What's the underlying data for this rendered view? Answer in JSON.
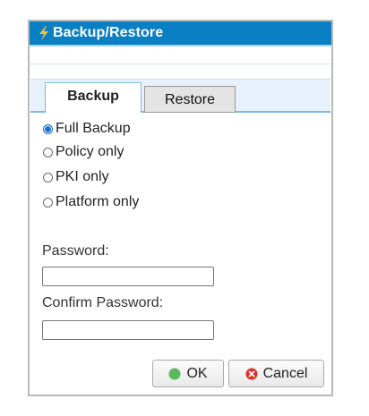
{
  "dialog": {
    "title": "Backup/Restore",
    "tabs": [
      {
        "label": "Backup",
        "active": true
      },
      {
        "label": "Restore",
        "active": false
      }
    ],
    "options": [
      {
        "label": "Full Backup",
        "selected": true
      },
      {
        "label": "Policy only",
        "selected": false
      },
      {
        "label": "PKI only",
        "selected": false
      },
      {
        "label": "Platform only",
        "selected": false
      }
    ],
    "password_label": "Password:",
    "password_value": "",
    "confirm_label": "Confirm Password:",
    "confirm_value": "",
    "ok_label": "OK",
    "cancel_label": "Cancel"
  },
  "colors": {
    "titlebar": "#0a7fc4",
    "ok_icon": "#5cb85c",
    "cancel_icon": "#d9342b",
    "title_icon": "#f6c33a"
  },
  "icons": {
    "title": "lightning-bolt-icon",
    "ok": "ok-circle-icon",
    "cancel": "cancel-x-circle-icon"
  }
}
